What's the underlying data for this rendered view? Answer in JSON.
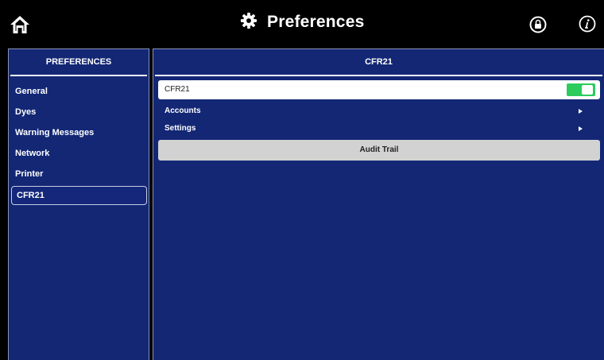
{
  "header": {
    "title": "Preferences",
    "icons": [
      "home-icon",
      "gear-icon",
      "lock-icon",
      "info-icon"
    ]
  },
  "sidebar": {
    "title": "PREFERENCES",
    "items": [
      {
        "label": "General"
      },
      {
        "label": "Dyes"
      },
      {
        "label": "Warning Messages"
      },
      {
        "label": "Network"
      },
      {
        "label": "Printer"
      },
      {
        "label": "CFR21",
        "selected": true
      }
    ]
  },
  "main": {
    "title": "CFR21",
    "cfr_toggle": {
      "label": "CFR21",
      "on": true
    },
    "rows": [
      {
        "label": "Accounts"
      },
      {
        "label": "Settings"
      }
    ],
    "audit_button": "Audit Trail"
  },
  "colors": {
    "panel_bg": "#132775",
    "toggle_on": "#2BCC5C",
    "button_bg": "#D2D2D2"
  }
}
